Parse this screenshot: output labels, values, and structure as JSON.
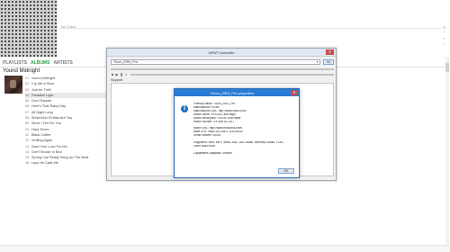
{
  "player": {
    "no_track": "No Track",
    "nav": {
      "playlists": "PLAYLISTS",
      "albums": "ALBUMS",
      "artists": "ARTISTS"
    },
    "album_title": "Yound Midnight",
    "tracks": [
      {
        "no": "01",
        "name": "Yound Midnight"
      },
      {
        "no": "02",
        "name": "Cry Me a River"
      },
      {
        "no": "03",
        "name": "Just for Thrill"
      },
      {
        "no": "04",
        "name": "Paradise Light"
      },
      {
        "no": "05",
        "name": "Don't Explain"
      },
      {
        "no": "06",
        "name": "Here's That Rainy Day"
      },
      {
        "no": "07",
        "name": "All Night Long"
      },
      {
        "no": "08",
        "name": "What Kind Of Man Are You"
      },
      {
        "no": "09",
        "name": "Since I Fell For You"
      },
      {
        "no": "10",
        "name": "Hard Times"
      },
      {
        "no": "11",
        "name": "Black Coffee"
      },
      {
        "no": "12",
        "name": "Smiling Again"
      },
      {
        "no": "13",
        "name": "Save Your Love For Me"
      },
      {
        "no": "14",
        "name": "Don't Smoke In Bed"
      },
      {
        "no": "15",
        "name": "Spring Can Really Hang Up The Most"
      },
      {
        "no": "16",
        "name": "Lazy He Calls Me"
      }
    ]
  },
  "upnp": {
    "title": "UPnP Controller",
    "device": "Thoro_iSR2_Pro",
    "go_label": "Go",
    "status": "Stopped"
  },
  "dialog": {
    "title": "Thoro_iSR2_Pro properties",
    "lines": [
      "Friendly Name: Thoro_iSR2_Pro",
      "Manufacturer: xx.inc",
      "Manufacturer URL: http://www.xxinc.com/",
      "Model name: XXXXv3 LinkPlayer",
      "Model description: XXXXv LinkPlayer",
      "Model number: XX Mar 16 2017",
      "",
      "Model URL: http://www.musiclink.com/",
      "Base URL: http://192.168.1.115:49152/",
      "Serial number: 00001",
      "",
      "Supported: WAV, MP3, WMA, AAC, AAC Audio, Monkey's Audio, FLAC",
      "Other audio mod",
      "",
      "Capabilities: playback, volume"
    ],
    "ok_label": "OK"
  }
}
